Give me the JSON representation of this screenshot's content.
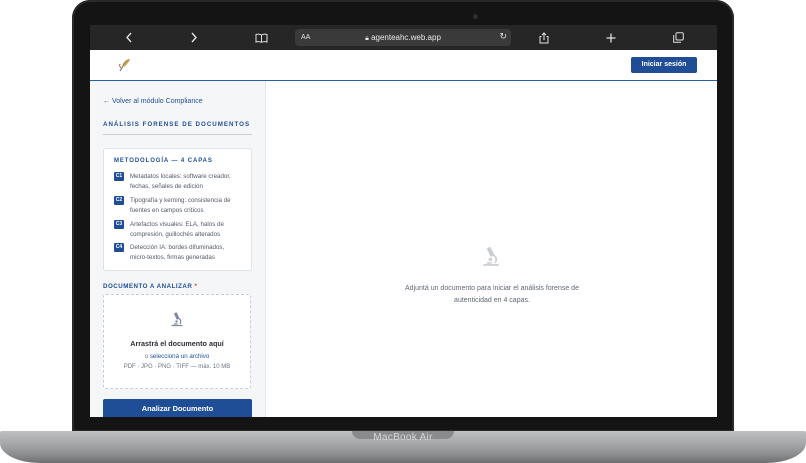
{
  "device": {
    "brand_label": "MacBook Air"
  },
  "browser": {
    "back_icon": "chevron-left-icon",
    "forward_icon": "chevron-right-icon",
    "bookmarks_icon": "book-icon",
    "text_size_label": "AA",
    "url": "agenteahc.web.app",
    "lock_icon": "lock-icon",
    "reload_icon": "reload-icon",
    "share_icon": "share-icon",
    "new_tab_icon": "plus-icon",
    "tabs_icon": "tabs-icon"
  },
  "header": {
    "logo_icon": "quill-logo-icon",
    "login_label": "Iniciar sesión"
  },
  "sidebar": {
    "back_link": "← Volver al módulo Compliance",
    "section_title": "ANÁLISIS FORENSE DE DOCUMENTOS",
    "methodology": {
      "title": "METODOLOGÍA — 4 CAPAS",
      "layers": [
        {
          "badge": "C1",
          "text": "Metadatos locales: software creador, fechas, señales de edición"
        },
        {
          "badge": "C2",
          "text": "Tipografía y kerning: consistencia de fuentes en campos críticos"
        },
        {
          "badge": "C3",
          "text": "Artefactos visuales: ELA, halos de compresión, guillochés alterados"
        },
        {
          "badge": "C4",
          "text": "Detección IA: bordes difuminados, micro-textos, firmas generadas"
        }
      ]
    },
    "document_label": "DOCUMENTO A ANALIZAR",
    "required_mark": "*",
    "dropzone": {
      "icon": "microscope-icon",
      "title": "Arrastrá el documento aquí",
      "or_text": "o",
      "pick_link": "seleccioná un archivo",
      "formats": "PDF · JPG · PNG · TIFF — máx. 10 MB"
    },
    "analyze_button": "Analizar Documento"
  },
  "main": {
    "empty_icon": "microscope-icon",
    "empty_message": "Adjuntá un documento para iniciar el análisis forense de autenticidad en 4 capas."
  },
  "colors": {
    "brand": "#1f4e96",
    "toolbar": "#262626",
    "sidebar_bg": "#f5f6f8",
    "required": "#d23b3b"
  }
}
